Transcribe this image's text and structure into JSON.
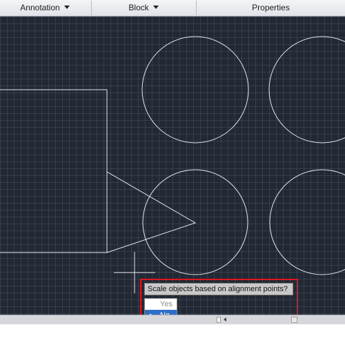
{
  "ribbon": {
    "panels": [
      {
        "label": "Annotation",
        "has_dropdown": true
      },
      {
        "label": "Block",
        "has_dropdown": true
      },
      {
        "label": "Properties",
        "has_dropdown": false
      }
    ]
  },
  "prompt": {
    "question": "Scale objects based on alignment points?",
    "options": [
      {
        "label": "Yes",
        "selected": false
      },
      {
        "label": "No",
        "selected": true
      }
    ]
  },
  "colors": {
    "canvas_background": "#222935",
    "geometry_stroke": "#e6e8ec",
    "highlight_border": "#e0161e",
    "menu_selection": "#2e6ec9"
  },
  "icons": {
    "dropdown": "chevron-down-icon",
    "cursor": "crosshair-cursor-icon"
  }
}
